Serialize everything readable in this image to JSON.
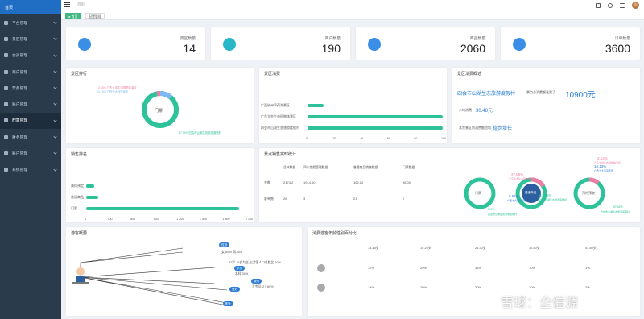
{
  "sidebar": {
    "home": "首页",
    "items": [
      {
        "label": "平台管理"
      },
      {
        "label": "景区管理"
      },
      {
        "label": "会员管理"
      },
      {
        "label": "商户管理"
      },
      {
        "label": "票务管理"
      },
      {
        "label": "账户管理"
      },
      {
        "label": "配置管理"
      },
      {
        "label": "财务管理"
      },
      {
        "label": "账户管理"
      },
      {
        "label": "系统管理"
      }
    ]
  },
  "topbar": {
    "breadcrumb": "首页"
  },
  "tags": {
    "home": "● 首页",
    "config": "配置管理"
  },
  "stats": [
    {
      "label": "景区数量",
      "value": "14",
      "color": "#3a8ee6",
      "icon": "globe-icon"
    },
    {
      "label": "商户数量",
      "value": "190",
      "color": "#28b7c9",
      "icon": "robot-icon"
    },
    {
      "label": "商品数量",
      "value": "2060",
      "color": "#3a8ee6",
      "icon": "cart-icon"
    },
    {
      "label": "订单数量",
      "value": "3600",
      "color": "#3a8ee6",
      "icon": "document-icon"
    }
  ],
  "ranking": {
    "title": "景区排行",
    "center": "门票",
    "lab1": "2.53% 广东大金生态园物体景区",
    "lab2": "10.13% 广西七大涉宗景区",
    "lab3": "87.34% 四会市山湖生态旅游度假村"
  },
  "consumption": {
    "title": "景区消费",
    "chart_data": {
      "type": "bar",
      "categories": [
        "广西钦州翠荷湖景区",
        "广东大金生态园物体景区",
        "四会市山湖生态旅游度假村"
      ],
      "values": [
        12,
        100,
        100
      ],
      "xticks": [
        "0",
        "20",
        "40",
        "60",
        "80",
        "100"
      ],
      "xlim": [
        0,
        100
      ]
    }
  },
  "overview": {
    "title": "景区消费概述",
    "name": "四会市山湖生态旅游度假村",
    "mid": "景点总消费额达到了",
    "amount": "10900元",
    "ratio_label": "人均消费",
    "ratio": "30.48元",
    "trend_label": "其余景区的消费额也均",
    "trend": "稳步增长"
  },
  "sales": {
    "title": "销售排名",
    "chart_data": {
      "type": "bar",
      "categories": [
        "预约预定",
        "普通商品",
        "门票"
      ],
      "values": [
        110,
        160,
        2000
      ],
      "xticks": [
        "0",
        "300",
        "600",
        "900",
        "1 200",
        "1 500",
        "1 800",
        "2 100"
      ],
      "xlim": [
        0,
        2100
      ]
    }
  },
  "realtime": {
    "title": "景点销售实时统计",
    "headers": [
      "",
      "总体数据",
      "四川度假管理数据",
      "普通商品销售数据",
      "门票数据"
    ],
    "rows": [
      [
        "金额",
        "2174.2",
        "1914.00",
        "162.20",
        "98.00"
      ],
      [
        "客单数",
        "26",
        "3",
        "21",
        "2"
      ]
    ],
    "donut1": "门票",
    "donut2": "普通商品",
    "donut3": "预约预定",
    "p1": "27.66%",
    "p1_label": "广东大金生态园物体景区",
    "p2": "8.51%",
    "p2_label": "广西七大涉宗景区",
    "p3": "100%",
    "p3_label": "四会市山湖生态旅游度假村",
    "p4": "63.82%",
    "p4_label": "四会市山湖生态旅游度假村",
    "p5": "2.53%",
    "p5_label": "广东大金生态园物体景区",
    "p6": "10.13%",
    "p6_label": "广西七大涉宗景区",
    "p7": "87.34%",
    "p7_label": "四会市山湖生态旅游度假村"
  },
  "visitors": {
    "title": "游客概要",
    "gender": "性别",
    "gender_text": "女 65%  男35%",
    "age_text": "32岁-35岁为主,占游客人口总数比 62%",
    "edu": "学历",
    "edu_text": "本科 30%",
    "edu_text2": "大专及以上60%",
    "hobby": "爱好",
    "hobby_text": "旅行",
    "job": "职业"
  },
  "agepct": {
    "title": "消费游客年龄性别百分比",
    "headers": [
      "",
      "13-18岁",
      "19-25岁",
      "26-30岁",
      "30-50岁",
      "51-60岁"
    ],
    "rows": [
      [
        "12%",
        "20%",
        "36%",
        "10%",
        "1%"
      ],
      [
        "14%",
        "20%",
        "30%",
        "20%",
        "2%"
      ]
    ]
  },
  "watermark": "雪球：企信源"
}
